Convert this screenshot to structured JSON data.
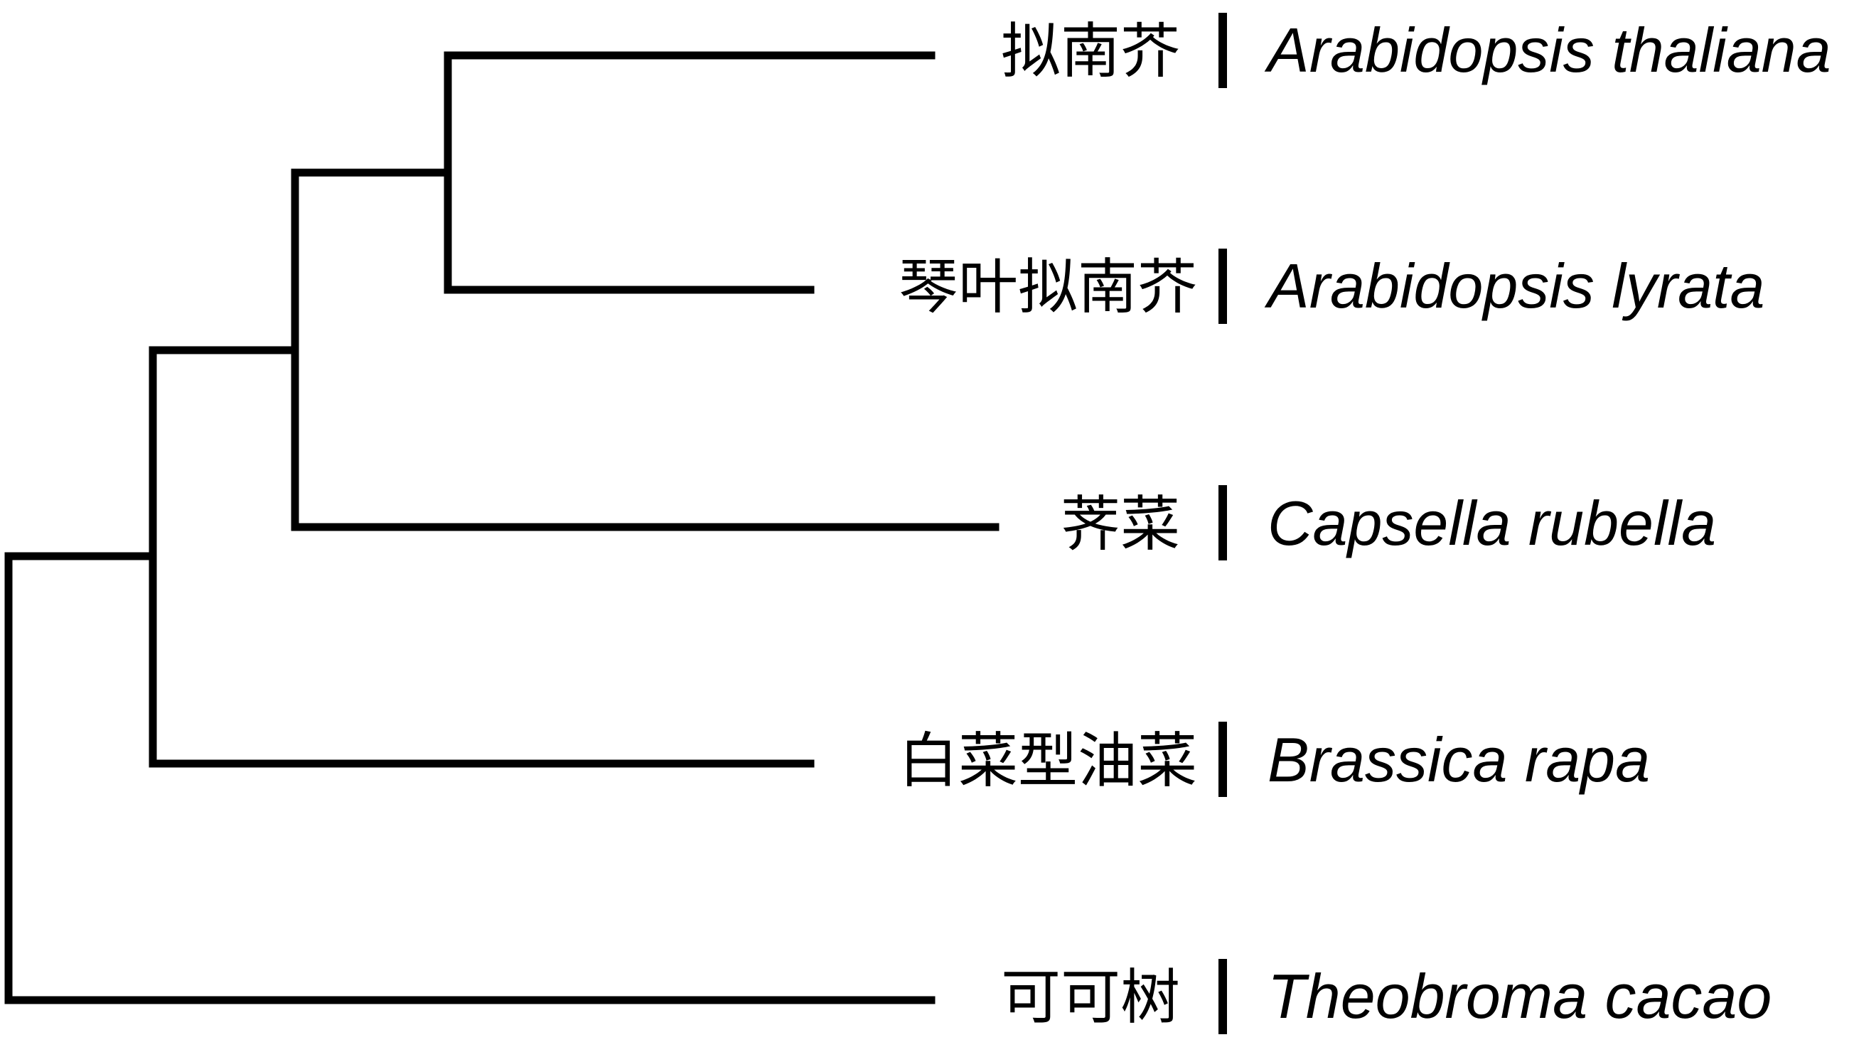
{
  "tree": {
    "taxa": [
      {
        "chinese": "拟南芥",
        "latin": "Arabidopsis thaliana"
      },
      {
        "chinese": "琴叶拟南芥",
        "latin": "Arabidopsis lyrata"
      },
      {
        "chinese": "荠菜",
        "latin": "Capsella rubella"
      },
      {
        "chinese": "白菜型油菜",
        "latin": "Brassica rapa"
      },
      {
        "chinese": "可可树",
        "latin": "Theobroma cacao"
      }
    ],
    "line_color": "#000000"
  }
}
